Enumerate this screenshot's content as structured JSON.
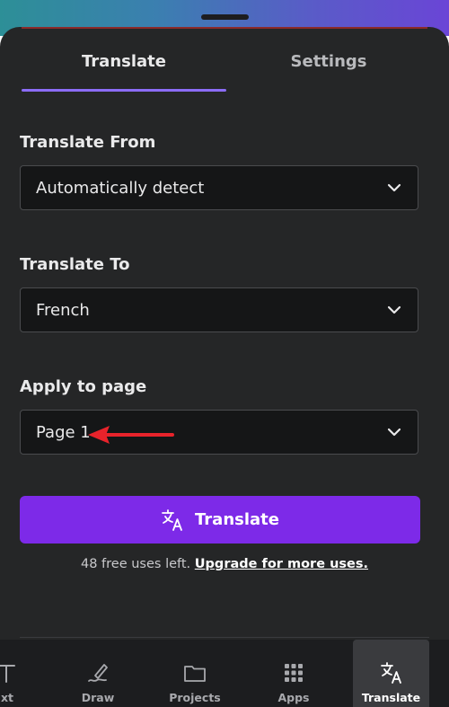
{
  "tabs": [
    {
      "label": "Translate",
      "active": true
    },
    {
      "label": "Settings",
      "active": false
    }
  ],
  "form": {
    "from_label": "Translate From",
    "from_value": "Automatically detect",
    "to_label": "Translate To",
    "to_value": "French",
    "page_label": "Apply to page",
    "page_value": "Page 1"
  },
  "action": {
    "button_label": "Translate",
    "uses_text": "48 free uses left.",
    "upgrade_link": "Upgrade for more uses."
  },
  "nav": [
    {
      "label": "xt",
      "icon": "text-icon"
    },
    {
      "label": "Draw",
      "icon": "draw-icon"
    },
    {
      "label": "Projects",
      "icon": "folder-icon"
    },
    {
      "label": "Apps",
      "icon": "apps-grid-icon"
    },
    {
      "label": "Translate",
      "icon": "translate-icon",
      "active": true
    }
  ],
  "colors": {
    "accent": "#8b6cf6",
    "button": "#7d2ae8",
    "panel": "#252627",
    "annotation_arrow": "#e8232b"
  }
}
